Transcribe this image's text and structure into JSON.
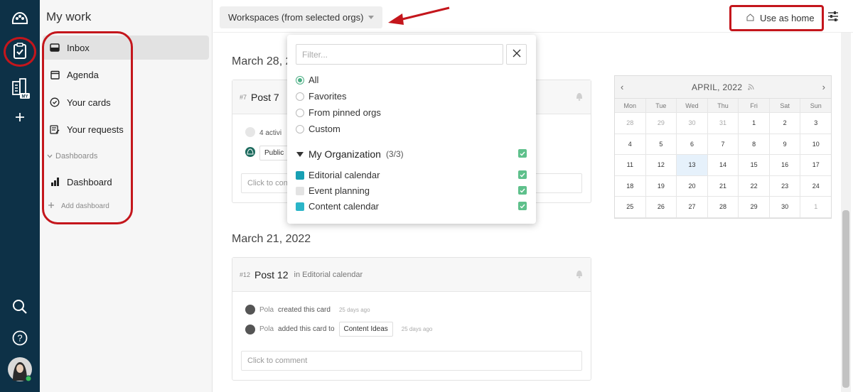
{
  "rail": {
    "logo_icon": "brand-logo-icon",
    "items": [
      {
        "name": "my-work-icon"
      },
      {
        "name": "workspaces-building-icon",
        "badge": "MY"
      },
      {
        "name": "plus-icon"
      }
    ],
    "bottom": [
      "search-icon",
      "help-icon",
      "avatar"
    ]
  },
  "sidebar": {
    "title": "My work",
    "items": [
      {
        "label": "Inbox",
        "icon": "inbox-icon",
        "active": true
      },
      {
        "label": "Agenda",
        "icon": "calendar-icon"
      },
      {
        "label": "Your cards",
        "icon": "check-circle-icon"
      },
      {
        "label": "Your requests",
        "icon": "requests-icon"
      }
    ],
    "section": "Dashboards",
    "dashboard": "Dashboard",
    "add_dashboard": "Add dashboard"
  },
  "topbar": {
    "workspace_select": "Workspaces (from selected orgs)",
    "use_as_home": "Use as home"
  },
  "dropdown": {
    "filter_placeholder": "Filter...",
    "options": [
      {
        "label": "All",
        "selected": true
      },
      {
        "label": "Favorites"
      },
      {
        "label": "From pinned orgs"
      },
      {
        "label": "Custom"
      }
    ],
    "org_name": "My Organization",
    "org_count": "(3/3)",
    "workspaces": [
      {
        "label": "Editorial calendar",
        "color": "#18a0b4",
        "checked": true
      },
      {
        "label": "Event planning",
        "color": "#e3e3e3",
        "checked": true
      },
      {
        "label": "Content calendar",
        "color": "#2bb5c8",
        "checked": true
      }
    ]
  },
  "feed": {
    "groups": [
      {
        "date": "March 28, 2",
        "card": {
          "num": "#7",
          "title": "Post 7",
          "activity_text": "4 activi",
          "chip": "Public",
          "comment_placeholder": "Click to con"
        }
      },
      {
        "date": "March 21, 2022",
        "card": {
          "num": "#12",
          "title": "Post 12",
          "in_label": "in Editorial calendar",
          "activities": [
            {
              "who": "Pola",
              "text": "created this card",
              "ago": "25 days ago"
            },
            {
              "who": "Pola",
              "text": "added this card to",
              "chip": "Content Ideas",
              "ago": "25 days ago"
            }
          ],
          "comment_placeholder": "Click to comment"
        }
      }
    ]
  },
  "calendar": {
    "month": "APRIL, 2022",
    "dow": [
      "Mon",
      "Tue",
      "Wed",
      "Thu",
      "Fri",
      "Sat",
      "Sun"
    ],
    "weeks": [
      [
        "28",
        "29",
        "30",
        "31",
        "1",
        "2",
        "3"
      ],
      [
        "4",
        "5",
        "6",
        "7",
        "8",
        "9",
        "10"
      ],
      [
        "11",
        "12",
        "13",
        "14",
        "15",
        "16",
        "17"
      ],
      [
        "18",
        "19",
        "20",
        "21",
        "22",
        "23",
        "24"
      ],
      [
        "25",
        "26",
        "27",
        "28",
        "29",
        "30",
        "1"
      ]
    ],
    "today": "13",
    "colors": {
      "today_bg": "#e6f1fb"
    }
  },
  "colors": {
    "rail_bg": "#0d3147",
    "accent_green": "#5ec08b",
    "annotation_red": "#c4161c"
  }
}
